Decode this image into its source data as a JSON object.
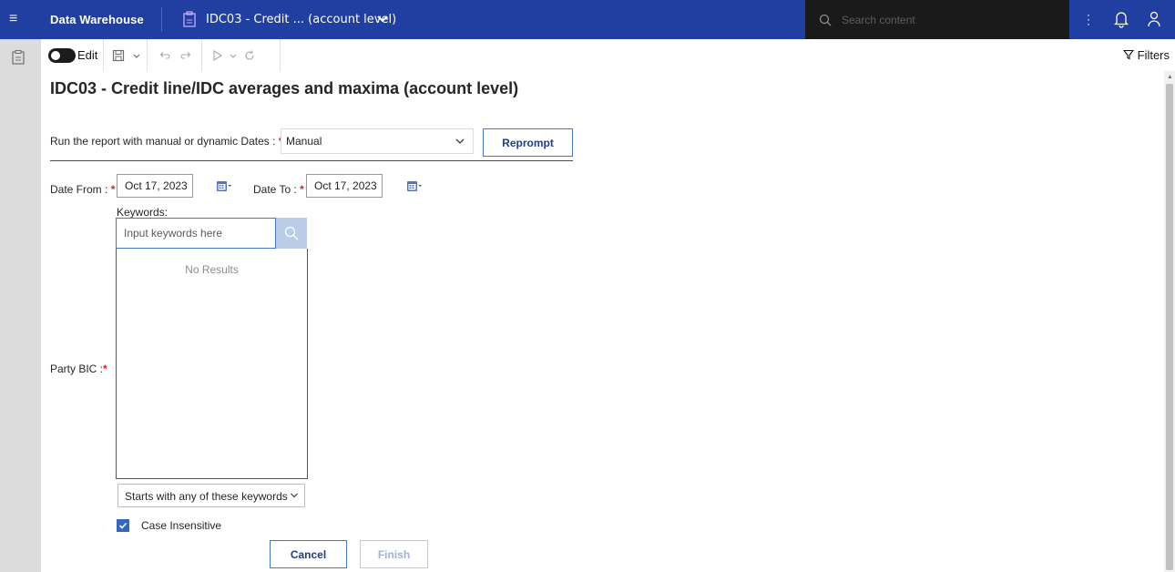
{
  "topbar": {
    "app_name": "Data Warehouse",
    "report_title": "IDC03 - Credit ... (account level)",
    "search_placeholder": "Search content",
    "kebab": "⋮",
    "menu_icon": "hamburger-menu-icon"
  },
  "toolbar": {
    "edit_label": "Edit",
    "filters_label": "Filters"
  },
  "page": {
    "title": "IDC03 - Credit line/IDC averages and maxima (account level)"
  },
  "prompt": {
    "run_label": "Run the report with manual or dynamic Dates :",
    "run_value": "Manual",
    "reprompt_label": "Reprompt",
    "required_mark": "*",
    "date_from_label": "Date From :",
    "date_from_value": "Oct 17, 2023",
    "date_to_label": "Date To :",
    "date_to_value": "Oct 17, 2023",
    "keywords_label": "Keywords:",
    "keywords_placeholder": "Input keywords here",
    "no_results": "No Results",
    "party_bic_label": "Party BIC  :",
    "match_option": "Starts with any of these keywords",
    "case_insensitive_label": "Case Insensitive",
    "case_insensitive_checked": true
  },
  "buttons": {
    "cancel": "Cancel",
    "finish": "Finish"
  },
  "colors": {
    "topbar": "#213fa0",
    "required": "#da1e28",
    "accent": "#4178be"
  }
}
